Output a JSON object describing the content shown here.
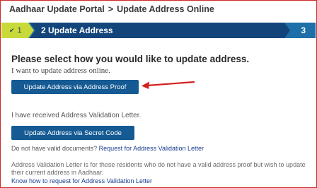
{
  "breadcrumb": {
    "portal": "Aadhaar Update Portal",
    "separator": ">",
    "current": "Update Address Online"
  },
  "stepper": {
    "step1_check_icon": "check-icon",
    "step1_number": "1",
    "step2_label": "2 Update Address",
    "step3_number": "3"
  },
  "main": {
    "heading": "Please select how you would like to update address.",
    "online_prompt": "I want to update address online.",
    "proof_button": "Update Address via Address Proof",
    "received_prompt": "I have received Address Validation Letter.",
    "secret_code_button": "Update Address via Secret Code",
    "no_docs_text": "Do not have valid documents?",
    "request_link": "Request for Address Validation Letter",
    "info_text": "Address Validation Letter is for those residents who do not have a valid address proof but wish to update their current address in Aadhaar.",
    "how_to_link": "Know how to request for Address Validation Letter"
  },
  "colors": {
    "primary_button": "#155a93",
    "step_bar": "#1f6fa8",
    "step_active": "#13457a",
    "step_done": "#c8d93a",
    "annotation_arrow": "#d42020",
    "link": "#1a3d8f"
  }
}
